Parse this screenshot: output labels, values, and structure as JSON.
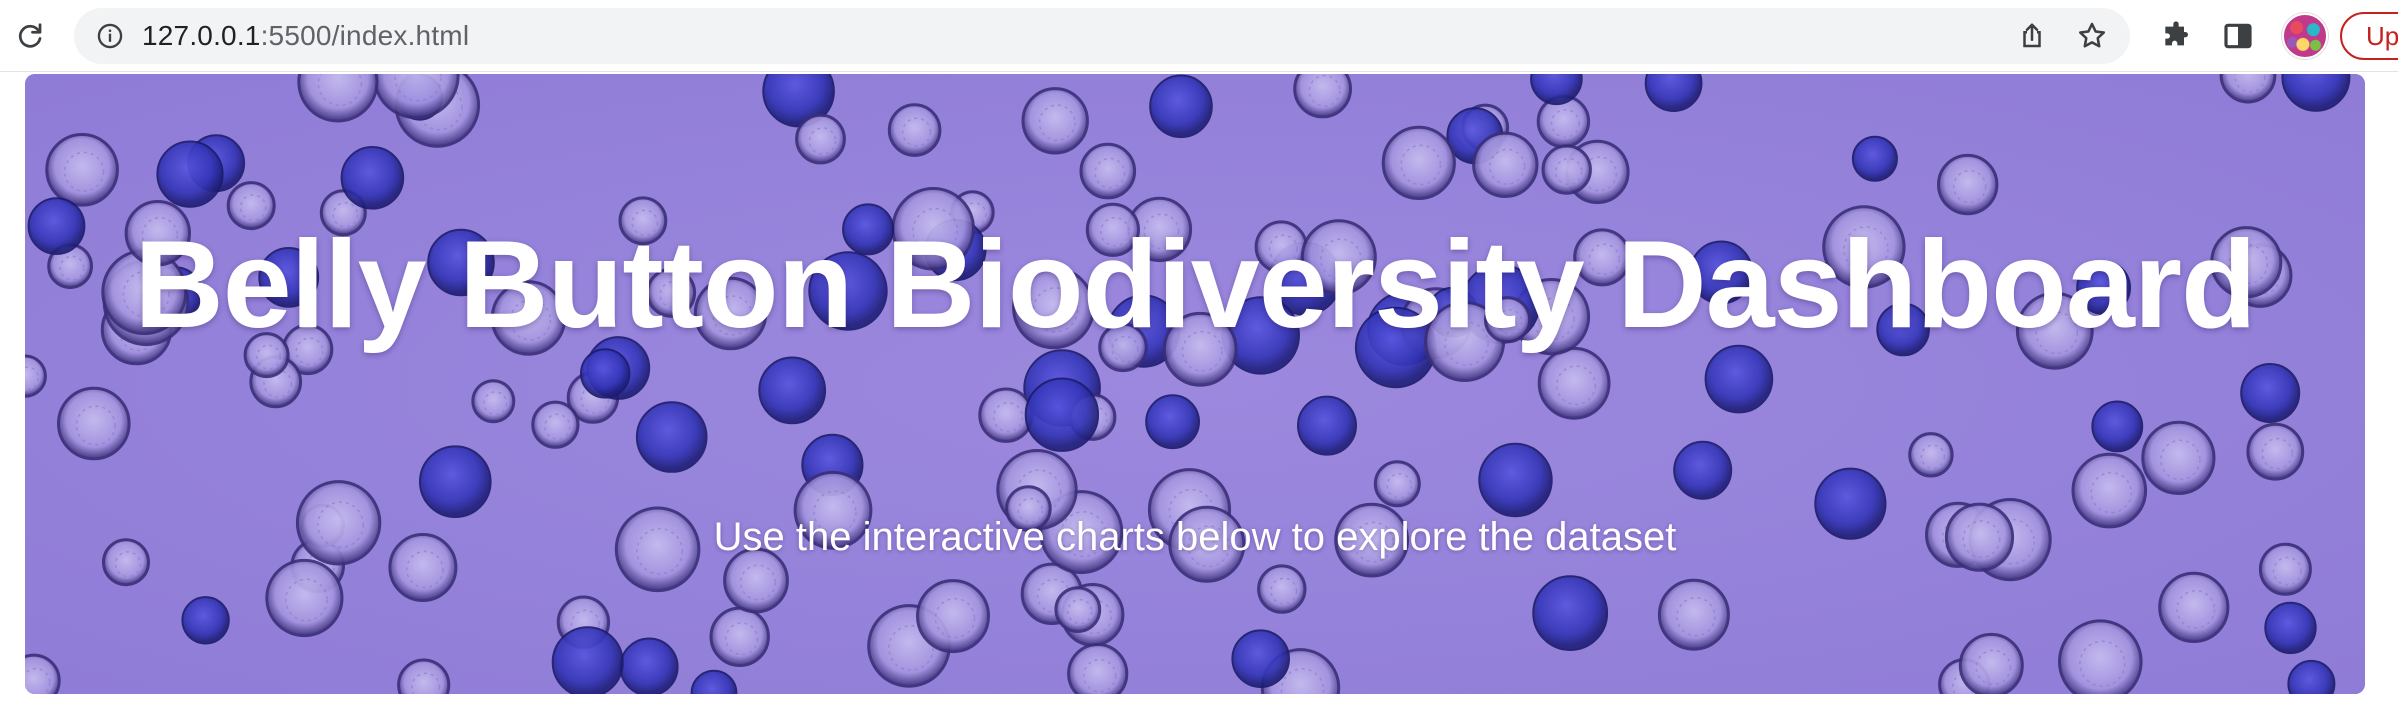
{
  "browser": {
    "url_host": "127.0.0.1",
    "url_rest": ":5500/index.html",
    "update_label": "Up",
    "icons": [
      "reload-icon",
      "info-icon",
      "share-icon",
      "star-icon",
      "extensions-icon",
      "side-panel-icon",
      "profile-avatar"
    ]
  },
  "hero": {
    "title": "Belly Button Biodiversity Dashboard",
    "subtitle": "Use the interactive charts below to explore the dataset",
    "background_color": "#9a86dc"
  }
}
